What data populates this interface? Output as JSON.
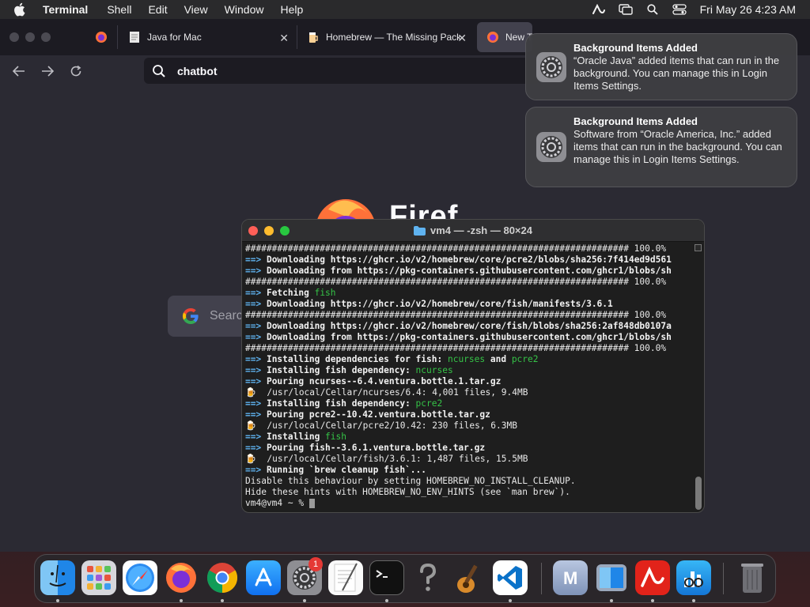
{
  "menubar": {
    "app_name": "Terminal",
    "items": [
      "Shell",
      "Edit",
      "View",
      "Window",
      "Help"
    ],
    "clock": "Fri May 26  4:23 AM"
  },
  "browser": {
    "tabs": [
      {
        "title": "Java for Mac"
      },
      {
        "title": "Homebrew — The Missing Package"
      },
      {
        "title": "New Tab"
      }
    ],
    "url_text": "chatbot",
    "firefox_word": "Firef",
    "google_placeholder": "Searc"
  },
  "notifications": [
    {
      "title": "Background Items Added",
      "body": "“Oracle Java” added items that can run in the background. You can manage this in Login Items Settings."
    },
    {
      "title": "Background Items Added",
      "body": "Software from “Oracle America, Inc.” added items that can run in the background. You can manage this in Login Items Settings."
    }
  ],
  "terminal": {
    "title": "vm4 — -zsh — 80×24",
    "lines": [
      [
        {
          "t": "######################################################################## 100.0%",
          "c": ""
        }
      ],
      [
        {
          "t": "==> ",
          "c": "arrow"
        },
        {
          "t": "Downloading https://ghcr.io/v2/homebrew/core/pcre2/blobs/sha256:7f414ed9d561",
          "c": "bold"
        }
      ],
      [
        {
          "t": "==> ",
          "c": "arrow"
        },
        {
          "t": "Downloading from https://pkg-containers.githubusercontent.com/ghcr1/blobs/sh",
          "c": "bold"
        }
      ],
      [
        {
          "t": "######################################################################## 100.0%",
          "c": ""
        }
      ],
      [
        {
          "t": "==> ",
          "c": "arrow"
        },
        {
          "t": "Fetching ",
          "c": "bold"
        },
        {
          "t": "fish",
          "c": "green"
        }
      ],
      [
        {
          "t": "==> ",
          "c": "arrow"
        },
        {
          "t": "Downloading https://ghcr.io/v2/homebrew/core/fish/manifests/3.6.1",
          "c": "bold"
        }
      ],
      [
        {
          "t": "######################################################################## 100.0%",
          "c": ""
        }
      ],
      [
        {
          "t": "==> ",
          "c": "arrow"
        },
        {
          "t": "Downloading https://ghcr.io/v2/homebrew/core/fish/blobs/sha256:2af848db0107a",
          "c": "bold"
        }
      ],
      [
        {
          "t": "==> ",
          "c": "arrow"
        },
        {
          "t": "Downloading from https://pkg-containers.githubusercontent.com/ghcr1/blobs/sh",
          "c": "bold"
        }
      ],
      [
        {
          "t": "######################################################################## 100.0%",
          "c": ""
        }
      ],
      [
        {
          "t": "==> ",
          "c": "arrow"
        },
        {
          "t": "Installing dependencies for fish: ",
          "c": "bold"
        },
        {
          "t": "ncurses",
          "c": "green"
        },
        {
          "t": " and ",
          "c": "bold"
        },
        {
          "t": "pcre2",
          "c": "green"
        }
      ],
      [
        {
          "t": "==> ",
          "c": "arrow"
        },
        {
          "t": "Installing fish dependency: ",
          "c": "bold"
        },
        {
          "t": "ncurses",
          "c": "green"
        }
      ],
      [
        {
          "t": "==> ",
          "c": "arrow"
        },
        {
          "t": "Pouring ncurses--6.4.ventura.bottle.1.tar.gz",
          "c": "bold"
        }
      ],
      [
        {
          "t": "🍺  ",
          "c": ""
        },
        {
          "t": "/usr/local/Cellar/ncurses/6.4: 4,001 files, 9.4MB",
          "c": ""
        }
      ],
      [
        {
          "t": "==> ",
          "c": "arrow"
        },
        {
          "t": "Installing fish dependency: ",
          "c": "bold"
        },
        {
          "t": "pcre2",
          "c": "green"
        }
      ],
      [
        {
          "t": "==> ",
          "c": "arrow"
        },
        {
          "t": "Pouring pcre2--10.42.ventura.bottle.tar.gz",
          "c": "bold"
        }
      ],
      [
        {
          "t": "🍺  ",
          "c": ""
        },
        {
          "t": "/usr/local/Cellar/pcre2/10.42: 230 files, 6.3MB",
          "c": ""
        }
      ],
      [
        {
          "t": "==> ",
          "c": "arrow"
        },
        {
          "t": "Installing ",
          "c": "bold"
        },
        {
          "t": "fish",
          "c": "green"
        }
      ],
      [
        {
          "t": "==> ",
          "c": "arrow"
        },
        {
          "t": "Pouring fish--3.6.1.ventura.bottle.tar.gz",
          "c": "bold"
        }
      ],
      [
        {
          "t": "🍺  ",
          "c": ""
        },
        {
          "t": "/usr/local/Cellar/fish/3.6.1: 1,487 files, 15.5MB",
          "c": ""
        }
      ],
      [
        {
          "t": "==> ",
          "c": "arrow"
        },
        {
          "t": "Running `brew cleanup fish`...",
          "c": "bold"
        }
      ],
      [
        {
          "t": "Disable this behaviour by setting HOMEBREW_NO_INSTALL_CLEANUP.",
          "c": ""
        }
      ],
      [
        {
          "t": "Hide these hints with HOMEBREW_NO_ENV_HINTS (see `man brew`).",
          "c": ""
        }
      ],
      [
        {
          "t": "vm4@vm4 ~ % ",
          "c": ""
        }
      ]
    ]
  },
  "dock": {
    "apps": [
      {
        "name": "finder",
        "running": true
      },
      {
        "name": "launchpad",
        "running": false
      },
      {
        "name": "safari",
        "running": false
      },
      {
        "name": "firefox",
        "running": true
      },
      {
        "name": "chrome",
        "running": true
      },
      {
        "name": "app-store",
        "running": false
      },
      {
        "name": "system-settings",
        "running": true,
        "badge": "1"
      },
      {
        "name": "textedit",
        "running": false
      },
      {
        "name": "terminal",
        "running": true
      },
      {
        "name": "help",
        "running": false
      },
      {
        "name": "garageband",
        "running": false
      },
      {
        "name": "vscode",
        "running": true
      },
      {
        "name": "utm",
        "running": false
      },
      {
        "name": "migration-assistant",
        "running": true
      },
      {
        "name": "avira",
        "running": true
      },
      {
        "name": "istatistica",
        "running": true
      },
      {
        "name": "trash",
        "running": false
      }
    ]
  },
  "colors": {
    "prompt_arrow": "#5fb3f0",
    "green_text": "#35c447",
    "badge_red": "#e53935"
  }
}
